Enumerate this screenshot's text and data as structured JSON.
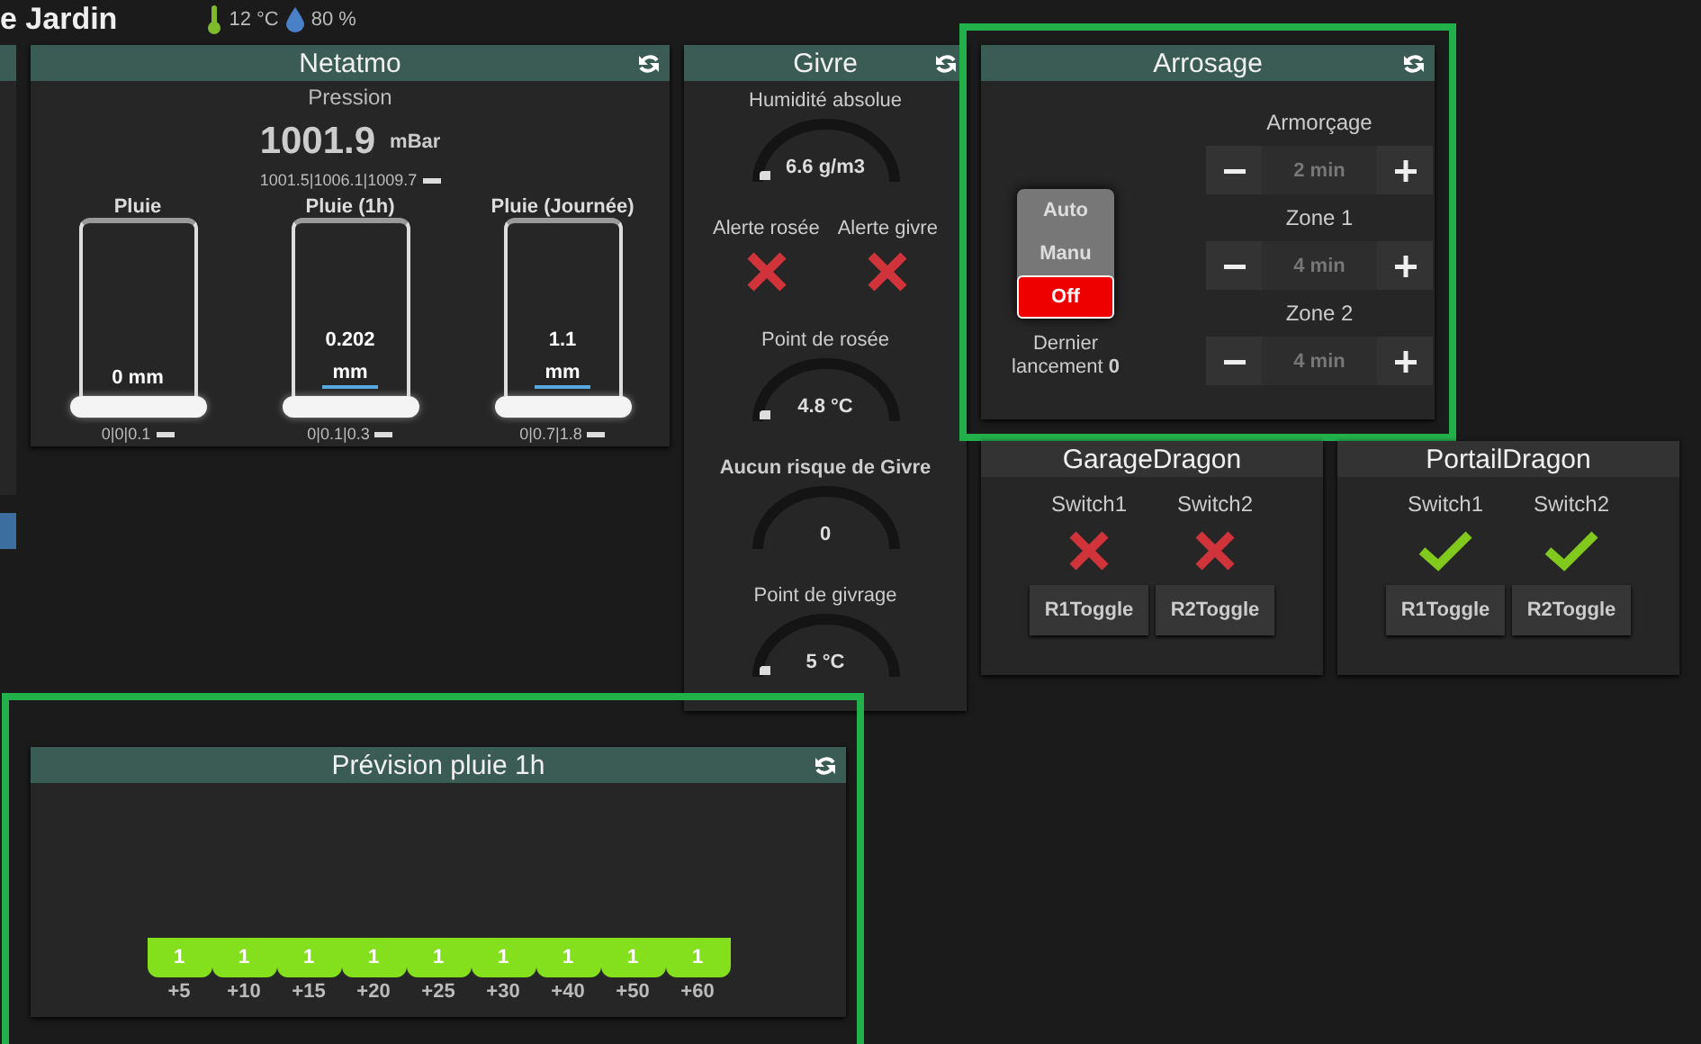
{
  "page": {
    "title": "e Jardin",
    "temperature": "12 °C",
    "humidity": "80 %"
  },
  "widgets": [
    {
      "kind": "netatmo",
      "title": "Netatmo",
      "refresh": true,
      "accent": true,
      "highlighted": false,
      "pressure": {
        "label": "Pression",
        "value": "1001.9",
        "unit": "mBar",
        "stats": "1001.5|1006.1|1009.7"
      },
      "rain": [
        {
          "name": "Pluie",
          "value": "0 mm",
          "stats": "0|0|0.1"
        },
        {
          "name": "Pluie (1h)",
          "value": "0.202",
          "unit": "mm",
          "stats": "0|0.1|0.3"
        },
        {
          "name": "Pluie (Journée)",
          "value": "1.1",
          "unit": "mm",
          "stats": "0|0.7|1.8"
        }
      ]
    },
    {
      "kind": "givre",
      "title": "Givre",
      "refresh": true,
      "accent": true,
      "highlighted": false,
      "items": [
        {
          "kind": "gauge",
          "label": "Humidité absolue",
          "value": "6.6 g/m3",
          "emphasis": false,
          "pointer": true
        },
        {
          "kind": "alerts",
          "alerts": [
            {
              "label": "Alerte rosée",
              "on": false
            },
            {
              "label": "Alerte givre",
              "on": false
            }
          ]
        },
        {
          "kind": "gauge",
          "label": "Point de rosée",
          "value": "4.8 °C",
          "emphasis": false,
          "pointer": true
        },
        {
          "kind": "gauge",
          "label": "Aucun risque de Givre",
          "value": "0",
          "emphasis": true,
          "pointer": false
        },
        {
          "kind": "gauge",
          "label": "Point de givrage",
          "value": "5 °C",
          "emphasis": false,
          "pointer": true
        }
      ]
    },
    {
      "kind": "arrosage",
      "title": "Arrosage",
      "refresh": true,
      "accent": true,
      "highlighted": true,
      "modes": [
        {
          "label": "Auto",
          "selected": false
        },
        {
          "label": "Manu",
          "selected": false
        },
        {
          "label": "Off",
          "selected": true
        }
      ],
      "last_run": "Dernier lancement **0**",
      "steppers": [
        {
          "label": "Armorçage",
          "value": "2 min"
        },
        {
          "label": "Zone 1",
          "value": "4 min"
        },
        {
          "label": "Zone 2",
          "value": "4 min"
        }
      ]
    },
    {
      "kind": "switches",
      "title": "GarageDragon",
      "refresh": false,
      "accent": false,
      "highlighted": false,
      "switches": [
        {
          "name": "Switch1",
          "on": false,
          "button": "R1Toggle"
        },
        {
          "name": "Switch2",
          "on": false,
          "button": "R2Toggle"
        }
      ]
    },
    {
      "kind": "switches",
      "title": "PortailDragon",
      "refresh": false,
      "accent": false,
      "highlighted": false,
      "switches": [
        {
          "name": "Switch1",
          "on": true,
          "button": "R1Toggle"
        },
        {
          "name": "Switch2",
          "on": true,
          "button": "R2Toggle"
        }
      ]
    },
    {
      "kind": "forecast",
      "title": "Prévision pluie 1h",
      "refresh": true,
      "accent": true,
      "highlighted": true,
      "slots": [
        {
          "label": "+5",
          "value": "1"
        },
        {
          "label": "+10",
          "value": "1"
        },
        {
          "label": "+15",
          "value": "1"
        },
        {
          "label": "+20",
          "value": "1"
        },
        {
          "label": "+25",
          "value": "1"
        },
        {
          "label": "+30",
          "value": "1"
        },
        {
          "label": "+40",
          "value": "1"
        },
        {
          "label": "+50",
          "value": "1"
        },
        {
          "label": "+60",
          "value": "1"
        }
      ]
    }
  ]
}
